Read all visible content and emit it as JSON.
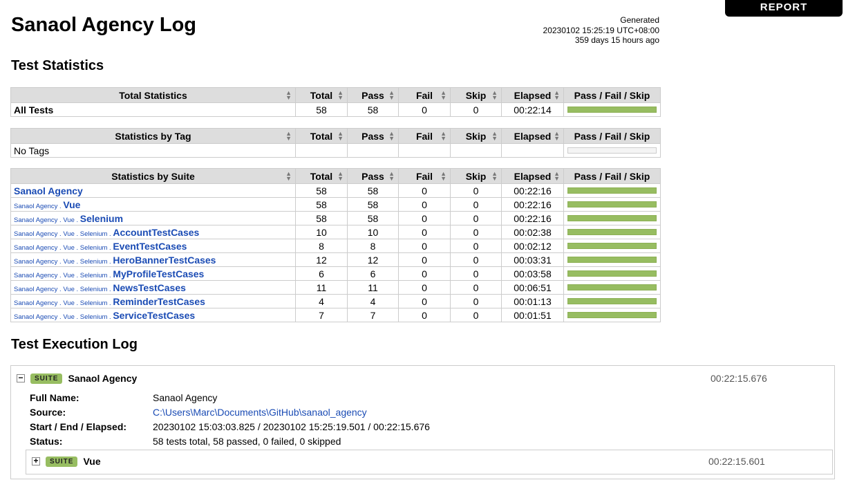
{
  "report_button": "REPORT",
  "title": "Sanaol Agency Log",
  "generated": {
    "label": "Generated",
    "timestamp": "20230102 15:25:19 UTC+08:00",
    "ago": "359 days 15 hours ago"
  },
  "sections": {
    "statistics": "Test Statistics",
    "execution": "Test Execution Log"
  },
  "columns": [
    "Total",
    "Pass",
    "Fail",
    "Skip",
    "Elapsed",
    "Pass / Fail / Skip"
  ],
  "total_stats": {
    "header": "Total Statistics",
    "rows": [
      {
        "name": "All Tests",
        "total": "58",
        "pass": "58",
        "fail": "0",
        "skip": "0",
        "elapsed": "00:22:14",
        "pass_fraction": 1.0
      }
    ]
  },
  "tag_stats": {
    "header": "Statistics by Tag",
    "empty": "No Tags"
  },
  "suite_stats": {
    "header": "Statistics by Suite",
    "rows": [
      {
        "parent": [],
        "name": "Sanaol Agency",
        "total": "58",
        "pass": "58",
        "fail": "0",
        "skip": "0",
        "elapsed": "00:22:16",
        "pass_fraction": 1.0
      },
      {
        "parent": [
          "Sanaol Agency"
        ],
        "name": "Vue",
        "total": "58",
        "pass": "58",
        "fail": "0",
        "skip": "0",
        "elapsed": "00:22:16",
        "pass_fraction": 1.0
      },
      {
        "parent": [
          "Sanaol Agency",
          "Vue"
        ],
        "name": "Selenium",
        "total": "58",
        "pass": "58",
        "fail": "0",
        "skip": "0",
        "elapsed": "00:22:16",
        "pass_fraction": 1.0
      },
      {
        "parent": [
          "Sanaol Agency",
          "Vue",
          "Selenium"
        ],
        "name": "AccountTestCases",
        "total": "10",
        "pass": "10",
        "fail": "0",
        "skip": "0",
        "elapsed": "00:02:38",
        "pass_fraction": 1.0
      },
      {
        "parent": [
          "Sanaol Agency",
          "Vue",
          "Selenium"
        ],
        "name": "EventTestCases",
        "total": "8",
        "pass": "8",
        "fail": "0",
        "skip": "0",
        "elapsed": "00:02:12",
        "pass_fraction": 1.0
      },
      {
        "parent": [
          "Sanaol Agency",
          "Vue",
          "Selenium"
        ],
        "name": "HeroBannerTestCases",
        "total": "12",
        "pass": "12",
        "fail": "0",
        "skip": "0",
        "elapsed": "00:03:31",
        "pass_fraction": 1.0
      },
      {
        "parent": [
          "Sanaol Agency",
          "Vue",
          "Selenium"
        ],
        "name": "MyProfileTestCases",
        "total": "6",
        "pass": "6",
        "fail": "0",
        "skip": "0",
        "elapsed": "00:03:58",
        "pass_fraction": 1.0
      },
      {
        "parent": [
          "Sanaol Agency",
          "Vue",
          "Selenium"
        ],
        "name": "NewsTestCases",
        "total": "11",
        "pass": "11",
        "fail": "0",
        "skip": "0",
        "elapsed": "00:06:51",
        "pass_fraction": 1.0
      },
      {
        "parent": [
          "Sanaol Agency",
          "Vue",
          "Selenium"
        ],
        "name": "ReminderTestCases",
        "total": "4",
        "pass": "4",
        "fail": "0",
        "skip": "0",
        "elapsed": "00:01:13",
        "pass_fraction": 1.0
      },
      {
        "parent": [
          "Sanaol Agency",
          "Vue",
          "Selenium"
        ],
        "name": "ServiceTestCases",
        "total": "7",
        "pass": "7",
        "fail": "0",
        "skip": "0",
        "elapsed": "00:01:51",
        "pass_fraction": 1.0
      }
    ]
  },
  "execution": {
    "suite": {
      "badge": "SUITE",
      "name": "Sanaol Agency",
      "elapsed": "00:22:15.676",
      "toggle": "−",
      "meta": [
        {
          "label": "Full Name:",
          "value": "Sanaol Agency"
        },
        {
          "label": "Source:",
          "value": "C:\\Users\\Marc\\Documents\\GitHub\\sanaol_agency",
          "link": true
        },
        {
          "label": "Start / End / Elapsed:",
          "value": "20230102 15:03:03.825 / 20230102 15:25:19.501 / 00:22:15.676"
        },
        {
          "label": "Status:",
          "value": "58 tests total, 58 passed, 0 failed, 0 skipped"
        }
      ]
    },
    "child": {
      "badge": "SUITE",
      "name": "Vue",
      "elapsed": "00:22:15.601",
      "toggle": "+"
    }
  },
  "colors": {
    "pass_bar": "#97bd61",
    "link": "#1a4bb4",
    "header_bg": "#dddddd"
  }
}
